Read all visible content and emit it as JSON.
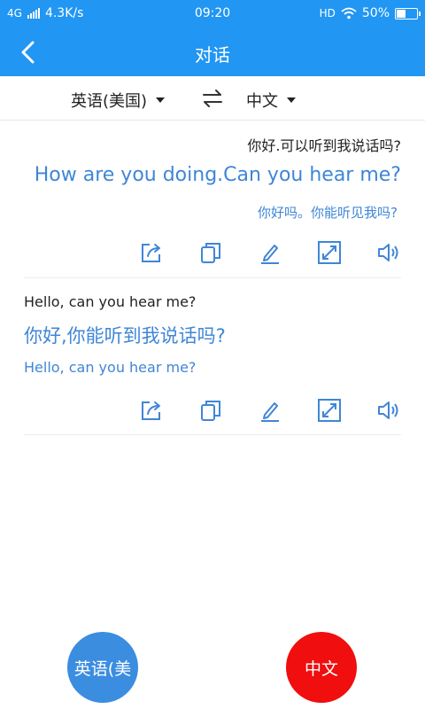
{
  "status": {
    "network": "4G",
    "speed": "4.3K/s",
    "time": "09:20",
    "hd": "HD",
    "battery_text": "50%",
    "battery_level": 0.5
  },
  "header": {
    "title": "对话",
    "back_icon": "back-arrow-icon"
  },
  "language_bar": {
    "source": "英语(美国)",
    "target": "中文",
    "swap_icon": "swap-arrows-icon"
  },
  "conversations": [
    {
      "source_text": "你好.可以听到我说话吗?",
      "translation": "How are you doing.Can you hear me?",
      "back_translation": "你好吗。你能听见我吗?"
    },
    {
      "source_text": "Hello, can you hear me?",
      "translation": "你好,你能听到我说话吗?",
      "back_translation": "Hello, can you hear me?"
    }
  ],
  "action_icons": [
    "share-icon",
    "copy-icon",
    "edit-icon",
    "fullscreen-icon",
    "speaker-icon"
  ],
  "buttons": {
    "left_label": "英语(美",
    "right_label": "中文"
  },
  "colors": {
    "primary": "#2196f3",
    "translation_text": "#3f86d6",
    "left_button": "#3b8de0",
    "right_button": "#f00e0e"
  }
}
